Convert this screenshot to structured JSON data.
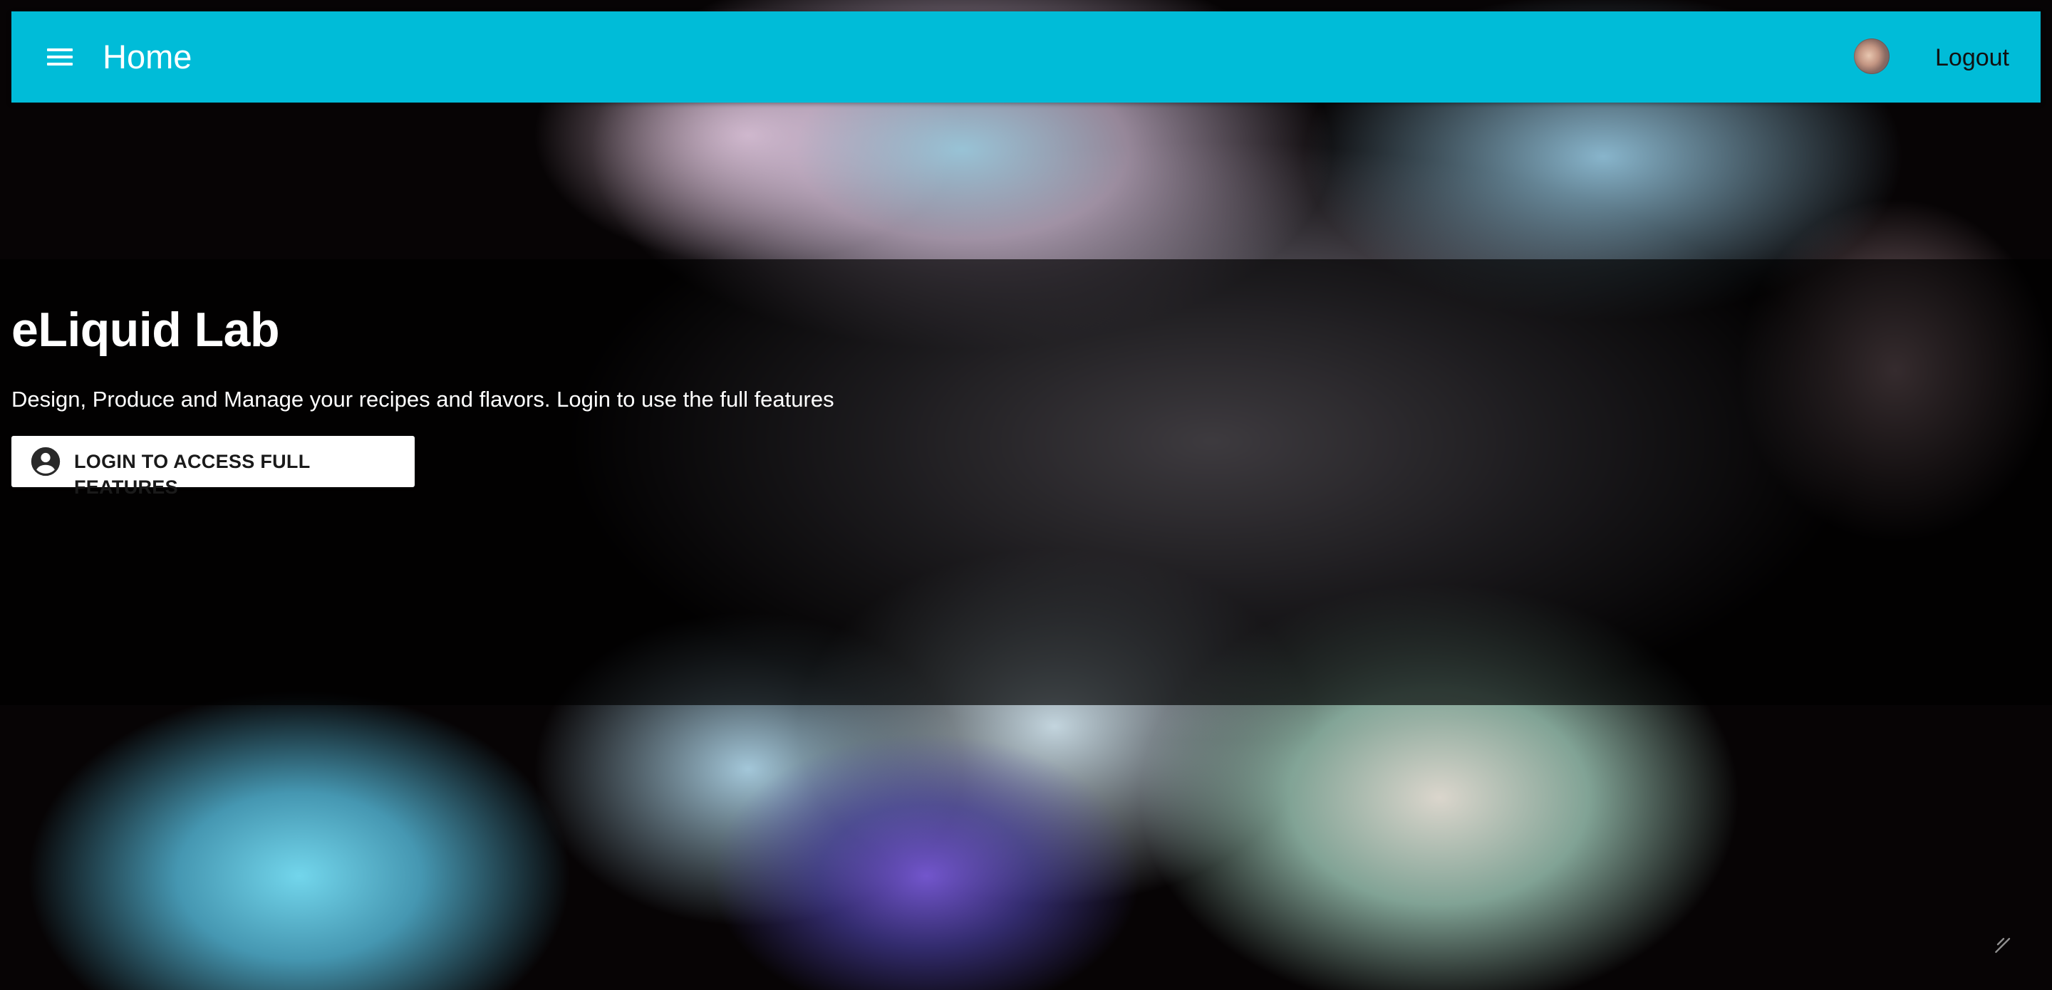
{
  "appbar": {
    "title": "Home",
    "menu_icon": "menu-icon",
    "avatar_icon": "user-avatar",
    "logout_label": "Logout",
    "color": "#00bcd8"
  },
  "hero": {
    "title": "eLiquid Lab",
    "subtitle": "Design, Produce and Manage your recipes and flavors. Login to use the full features",
    "button_icon": "account-circle-icon",
    "button_label": "LOGIN TO ACCESS FULL FEATURES"
  },
  "footer": {
    "corner_icon": "feather-icon"
  }
}
